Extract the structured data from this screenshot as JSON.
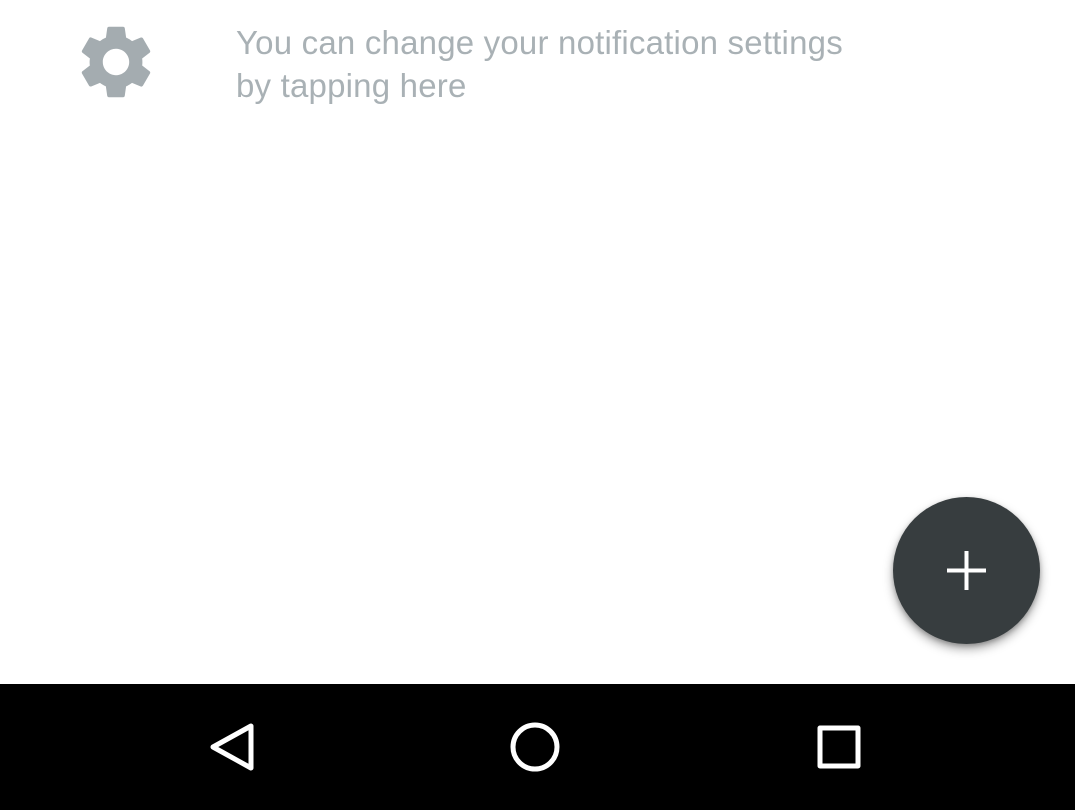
{
  "hint": {
    "text": "You can change your notification settings by tapping here",
    "settings_icon": "gear-icon"
  },
  "fab": {
    "icon": "plus-icon",
    "color": "#373d3f"
  },
  "navbar": {
    "back_icon": "back-triangle-icon",
    "home_icon": "home-circle-icon",
    "recents_icon": "recents-square-icon"
  },
  "colors": {
    "hint_text": "#a9b1b5",
    "icon_gray": "#a4acb0",
    "navbar_bg": "#000000"
  }
}
